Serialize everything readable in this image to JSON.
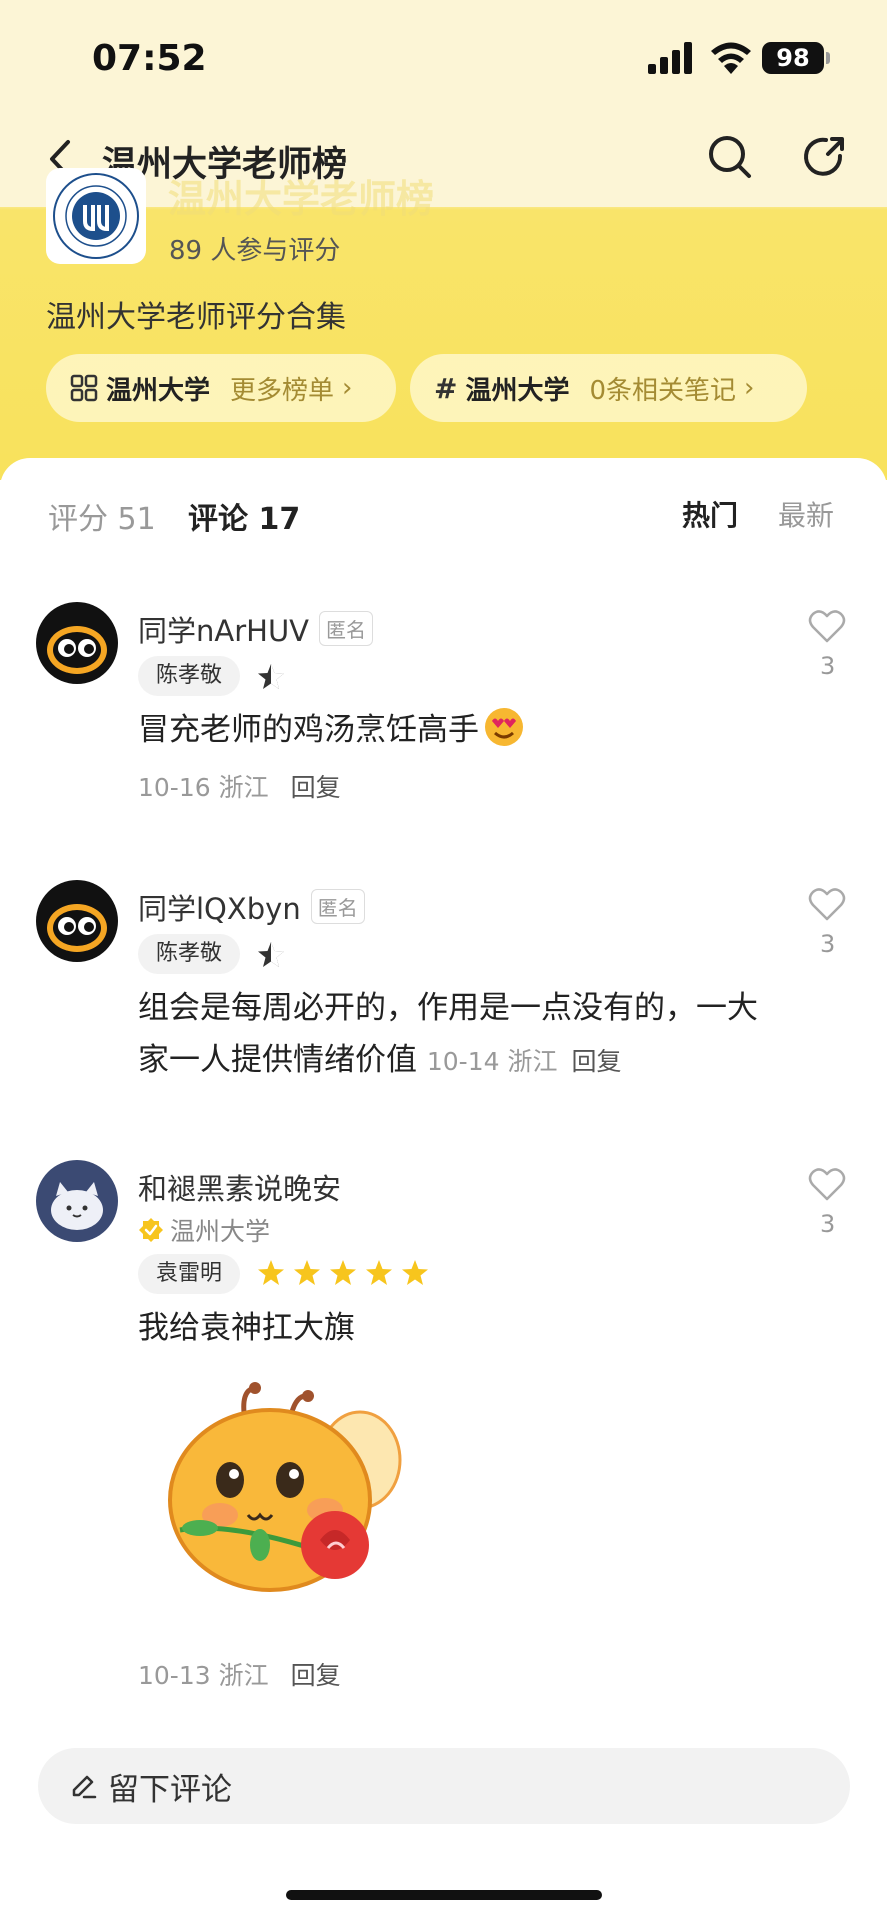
{
  "status": {
    "time": "07:52",
    "battery": "98"
  },
  "nav": {
    "title": "温州大学老师榜"
  },
  "board": {
    "participants": "89 人参与评分",
    "description": "温州大学老师评分合集",
    "pill1": {
      "label": "温州大学",
      "more": "更多榜单"
    },
    "pill2": {
      "label": "温州大学",
      "notes": "0条相关笔记"
    }
  },
  "tabs": {
    "score": "评分 51",
    "comment": "评论 17",
    "hot": "热门",
    "newest": "最新"
  },
  "comments": [
    {
      "user": "同学nArHUV",
      "anon": "匿名",
      "teacher": "陈孝敬",
      "text": "冒充老师的鸡汤烹饪高手",
      "emoji": "heart-eyes",
      "date": "10-16",
      "region": "浙江",
      "reply": "回复",
      "likes": "3"
    },
    {
      "user": "同学lQXbyn",
      "anon": "匿名",
      "teacher": "陈孝敬",
      "text": "组会是每周必开的，作用是一点没有的，一大家一人提供情绪价值",
      "date": "10-14",
      "region": "浙江",
      "reply": "回复",
      "likes": "3"
    },
    {
      "user": "和褪黑素说晚安",
      "verified": "温州大学",
      "teacher": "袁雷明",
      "rating": 5,
      "text": "我给袁神扛大旗",
      "date": "10-13",
      "region": "浙江",
      "reply": "回复",
      "likes": "3"
    }
  ],
  "input": {
    "placeholder": "留下评论"
  },
  "colors": {
    "accent_yellow": "#f8e25c",
    "star": "#f7c51d"
  }
}
